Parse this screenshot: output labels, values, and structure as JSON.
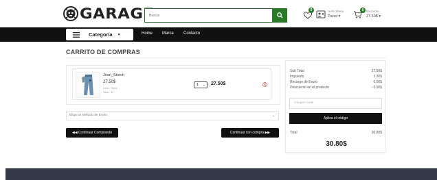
{
  "header": {
    "brand": "GARAGE",
    "search": {
      "placeholder": "Buscar"
    },
    "wishlist": {
      "count": "0"
    },
    "user": {
      "greeting": "Hello Elena",
      "panel_label": "Panel ▾"
    },
    "cart": {
      "count": "0",
      "label": "Mi carrito",
      "amount": "27.50$ ▾"
    }
  },
  "nav": {
    "category_label": "Categoría",
    "category_chevron": "▼",
    "links": [
      "Home",
      "Marca",
      "Contacto"
    ]
  },
  "main": {
    "title": "CARRITO DE COMPRAS",
    "item": {
      "name": "Jean_Strech",
      "price": "27.50$",
      "color": "color : Black",
      "size": "Talla : 32",
      "quantity": "1",
      "total": "27.50$"
    },
    "shipping_placeholder": "Eliga un Método de Envío",
    "continue_shopping": "◀◀ Continuar Comprando",
    "continue_checkout": "Continuar con compra ▶▶"
  },
  "summary": {
    "rows": [
      {
        "label": "Sub Total",
        "value": "27.50$"
      },
      {
        "label": "Impuesto",
        "value": "3.30$"
      },
      {
        "label": "Recargo de Envío",
        "value": "0.00$"
      },
      {
        "label": "Descuento en el producto",
        "value": "- 0.00$"
      }
    ],
    "coupon_placeholder": "Coupon code",
    "apply_label": "Aplica el código",
    "total_label": "Total",
    "total_value": "30.80$",
    "grand_total": "30.80$"
  },
  "colors": {
    "brand_green": "#2a7a2a",
    "nav_bg": "#111111",
    "footer_bg": "#323845",
    "remove_red": "#e05555"
  }
}
